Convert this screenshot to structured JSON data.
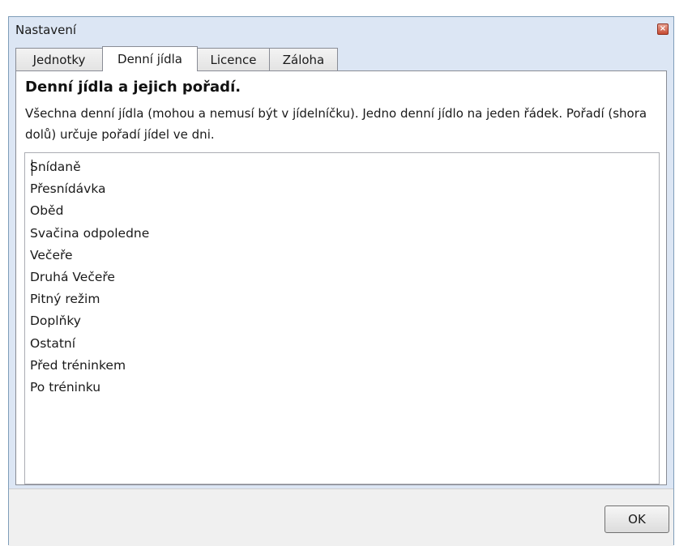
{
  "window": {
    "title": "Nastavení",
    "close_glyph": "×"
  },
  "tabs": [
    {
      "label": "Jednotky",
      "active": false
    },
    {
      "label": "Denní jídla",
      "active": true
    },
    {
      "label": "Licence",
      "active": false
    },
    {
      "label": "Záloha",
      "active": false
    }
  ],
  "panel": {
    "heading": "Denní jídla a jejich pořadí.",
    "description": "Všechna denní jídla (mohou a nemusí být v jídelníčku). Jedno denní jídlo na jeden řádek. Pořadí (shora dolů) určuje pořadí jídel ve dni.",
    "meals": [
      "Snídaně",
      "Přesnídávka",
      "Oběd",
      "Svačina odpoledne",
      "Večeře",
      "Druhá Večeře",
      "Pitný režim",
      "Doplňky",
      "Ostatní",
      "Před tréninkem",
      "Po tréninku"
    ]
  },
  "footer": {
    "ok_label": "OK"
  }
}
